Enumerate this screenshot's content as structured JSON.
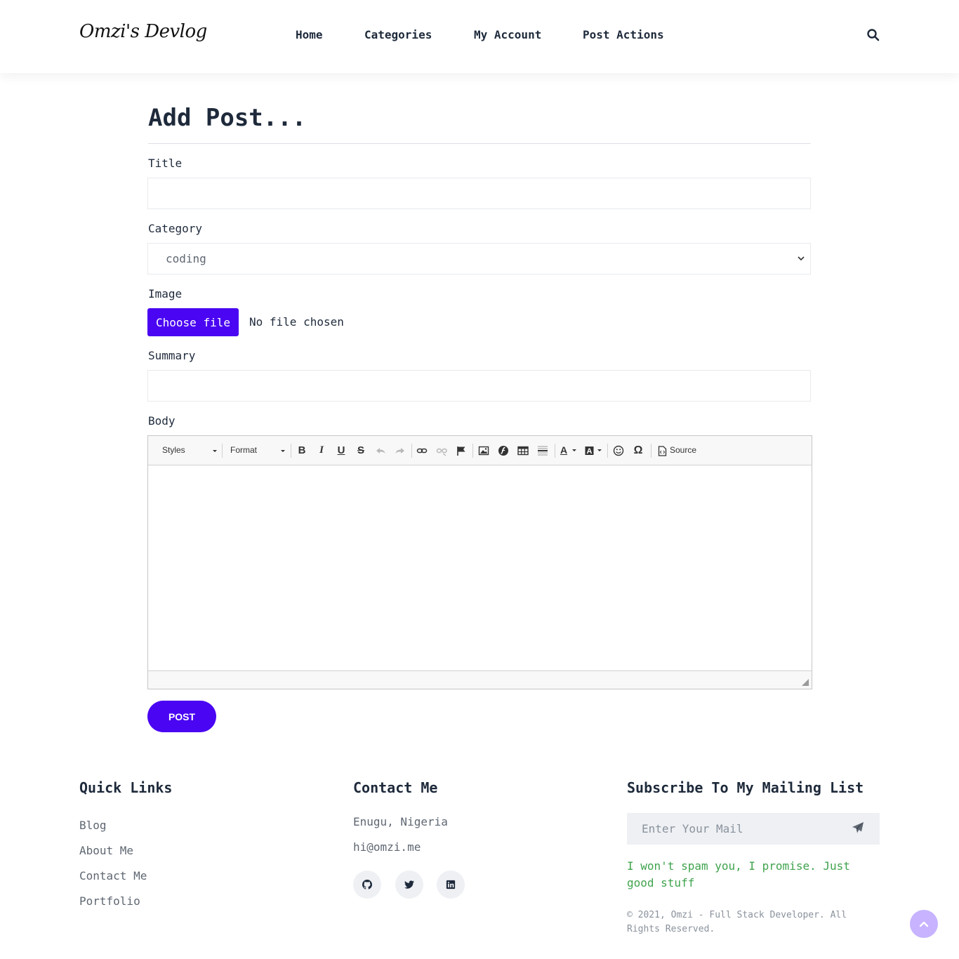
{
  "header": {
    "logo": "Omzi's Devlog",
    "nav": [
      {
        "label": "Home"
      },
      {
        "label": "Categories"
      },
      {
        "label": "My Account"
      },
      {
        "label": "Post Actions"
      }
    ],
    "search_icon": "search-icon"
  },
  "form": {
    "page_title": "Add Post...",
    "title_label": "Title",
    "title_value": "",
    "category_label": "Category",
    "category_selected": "coding",
    "image_label": "Image",
    "choose_file_label": "Choose file",
    "no_file_text": "No file chosen",
    "summary_label": "Summary",
    "summary_value": "",
    "body_label": "Body",
    "editor": {
      "styles_label": "Styles",
      "format_label": "Format",
      "source_label": "Source",
      "toolbar_icons": [
        "bold-icon",
        "italic-icon",
        "underline-icon",
        "strikethrough-icon",
        "undo-icon",
        "redo-icon",
        "link-icon",
        "unlink-icon",
        "anchor-flag-icon",
        "image-icon",
        "flash-icon",
        "table-icon",
        "horizontal-rule-icon",
        "text-color-icon",
        "background-color-icon",
        "smiley-icon",
        "special-char-omega-icon",
        "source-icon"
      ],
      "content": ""
    },
    "post_button": "POST"
  },
  "footer": {
    "quick_links_heading": "Quick Links",
    "quick_links": [
      "Blog",
      "About Me",
      "Contact Me",
      "Portfolio"
    ],
    "contact_heading": "Contact Me",
    "location": "Enugu, Nigeria",
    "email": "hi@omzi.me",
    "social_icons": [
      "github-icon",
      "twitter-icon",
      "linkedin-icon"
    ],
    "subscribe_heading": "Subscribe To My Mailing List",
    "mail_placeholder": "Enter Your Mail",
    "promise": "I won't spam you, I promise. Just good stuff",
    "copyright": "© 2021, Omzi - Full Stack Developer. All Rights Reserved."
  },
  "colors": {
    "accent": "#4a05f2",
    "text": "#1e2a3b",
    "muted": "#5f6772",
    "success": "#3fa34d",
    "back_to_top": "#c7b3ff"
  }
}
